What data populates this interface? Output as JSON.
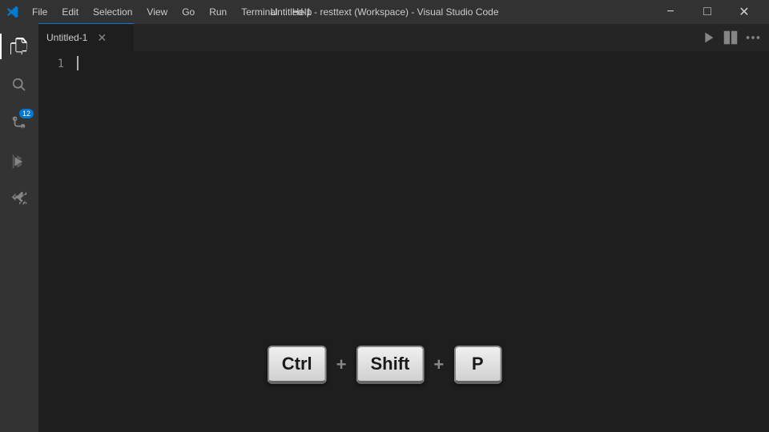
{
  "titlebar": {
    "title": "Untitled-1 - resttext (Workspace) - Visual Studio Code",
    "menu_items": [
      "File",
      "Edit",
      "Selection",
      "View",
      "Go",
      "Run",
      "Terminal",
      "Help"
    ]
  },
  "tabs": [
    {
      "label": "Untitled-1",
      "modified": false,
      "active": true
    }
  ],
  "editor": {
    "line_number": "1"
  },
  "activity_bar": {
    "items": [
      {
        "icon": "files-icon",
        "label": "Explorer"
      },
      {
        "icon": "search-icon",
        "label": "Search"
      },
      {
        "icon": "source-control-icon",
        "label": "Source Control",
        "badge": "12"
      },
      {
        "icon": "run-icon",
        "label": "Run"
      },
      {
        "icon": "extensions-icon",
        "label": "Extensions"
      }
    ]
  },
  "kbd_shortcut": {
    "keys": [
      "Ctrl",
      "Shift",
      "P"
    ],
    "plus_symbol": "+"
  }
}
